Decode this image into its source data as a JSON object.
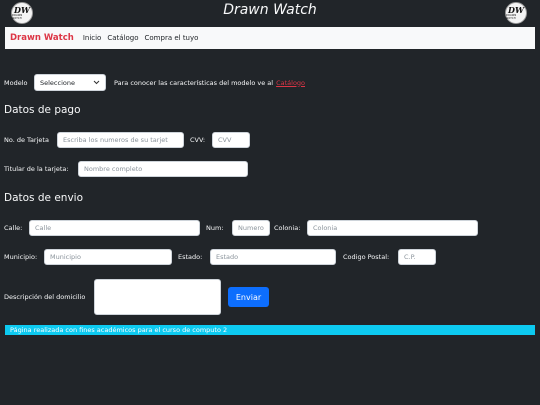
{
  "header": {
    "title": "Drawn Watch",
    "logo_text": "DW",
    "logo_sub": "DRAWN WATCH"
  },
  "navbar": {
    "brand": "Drawn Watch",
    "links": [
      "Inicio",
      "Catálogo",
      "Compra el tuyo"
    ]
  },
  "model": {
    "label": "Modelo",
    "select_value": "Seleccione",
    "info_text": "Para conocer las características del modelo ve al",
    "info_link": "Catálogo"
  },
  "payment": {
    "title": "Datos de pago",
    "card_label": "No. de Tarjeta",
    "card_placeholder": "Escriba los numeros de su tarjet",
    "cvv_label": "CVV:",
    "cvv_placeholder": "CVV",
    "holder_label": "Titular de la tarjeta:",
    "holder_placeholder": "Nombre completo"
  },
  "shipping": {
    "title": "Datos de envio",
    "street_label": "Calle:",
    "street_placeholder": "Calle",
    "number_label": "Num:",
    "number_placeholder": "Numero",
    "colony_label": "Colonia:",
    "colony_placeholder": "Colonia",
    "municipality_label": "Municipio:",
    "municipality_placeholder": "Municipio",
    "state_label": "Estado:",
    "state_placeholder": "Estado",
    "zip_label": "Codigo Postal:",
    "zip_placeholder": "C.P.",
    "address_desc_label": "Descripción del domicilio",
    "submit_label": "Enviar"
  },
  "footer": {
    "text": "Página realizada con fines académicos para el curso de computo 2"
  }
}
